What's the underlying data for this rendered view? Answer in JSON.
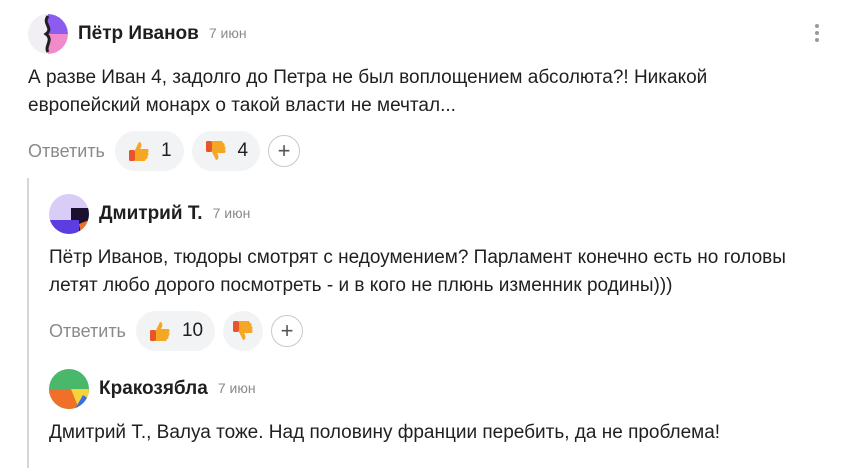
{
  "comments": [
    {
      "author": "Пётр Иванов",
      "date": "7 июн",
      "text": "А разве Иван 4, задолго до Петра не был воплощением абсолюта?! Никакой\nевропейский монарх о такой власти не мечтал...",
      "reply_label": "Ответить",
      "likes": "1",
      "dislikes": "4",
      "add_reaction": "+"
    },
    {
      "author": "Дмитрий Т.",
      "date": "7 июн",
      "text": "Пётр Иванов, тюдоры смотрят с недоумением? Парламент конечно есть но головы\nлетят любо дорого посмотреть - и в кого не плюнь изменник родины)))",
      "reply_label": "Ответить",
      "likes": "10",
      "add_reaction": "+"
    },
    {
      "author": "Кракозябла",
      "date": "7 июн",
      "text": "Дмитрий Т., Валуа тоже. Над половину франции перебить, да не проблема!"
    }
  ],
  "icons": {
    "like": "thumbs-up-icon",
    "dislike": "thumbs-down-icon",
    "more": "more-vertical-icon"
  },
  "colors": {
    "thumb": "#f5a623",
    "thumb_cuff": "#e8542c",
    "pill_bg": "#f2f3f5",
    "muted_text": "#8a8a8a"
  }
}
